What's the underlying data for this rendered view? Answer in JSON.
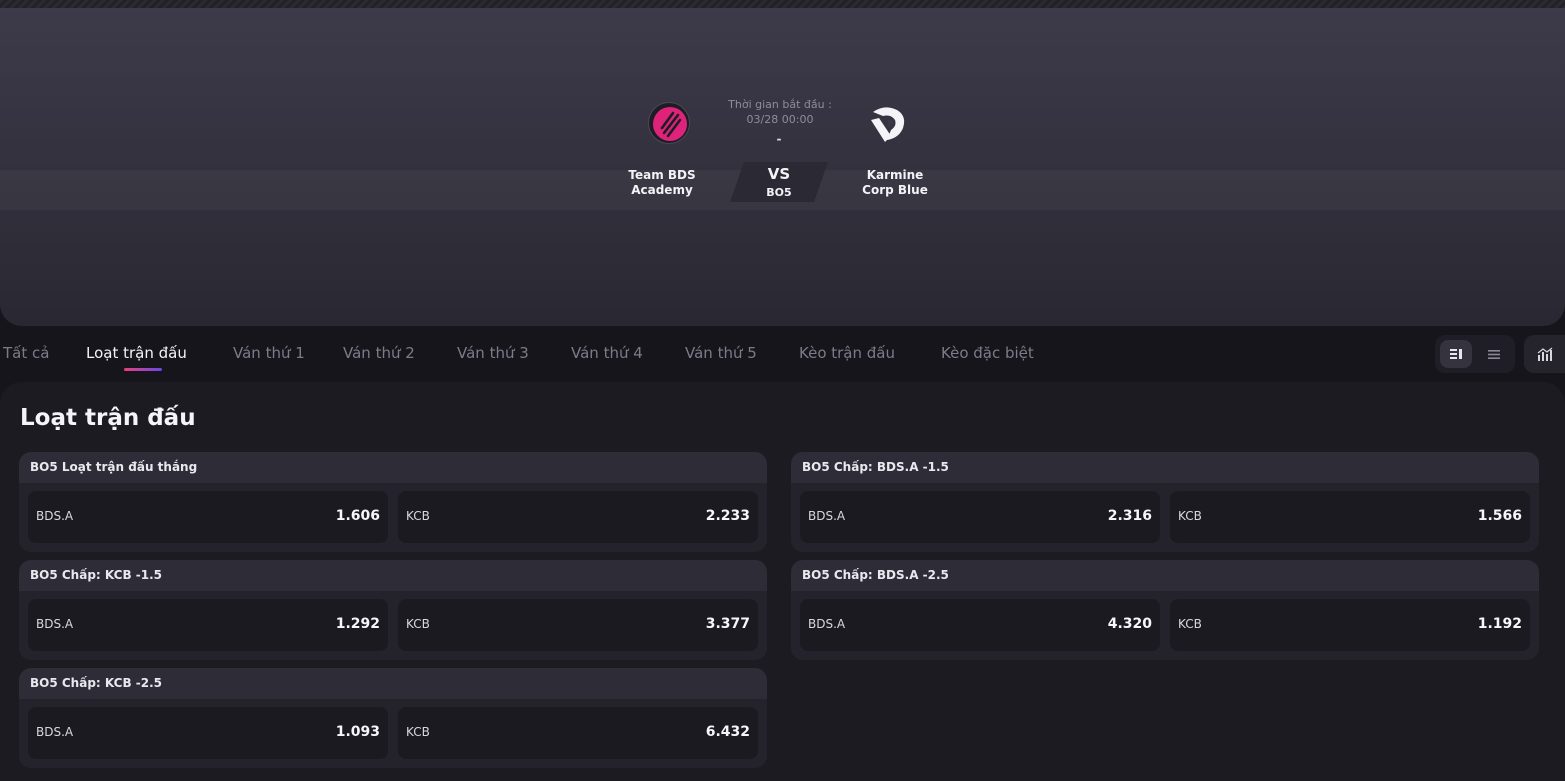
{
  "match": {
    "team_a": {
      "name": "Team BDS Academy",
      "line1": "Team BDS",
      "line2": "Academy",
      "logo": "bds-academy-logo"
    },
    "team_b": {
      "name": "Karmine Corp Blue",
      "line1": "Karmine",
      "line2": "Corp Blue",
      "logo": "karmine-corp-logo"
    },
    "start_label": "Thời gian bắt đầu :",
    "start_time": "03/28 00:00",
    "score": "-",
    "vs": "VS",
    "format": "BO5"
  },
  "tabs": [
    {
      "label": "Tất cả",
      "active": false
    },
    {
      "label": "Loạt trận đấu",
      "active": true
    },
    {
      "label": "Ván thứ 1",
      "active": false
    },
    {
      "label": "Ván thứ 2",
      "active": false
    },
    {
      "label": "Ván thứ 3",
      "active": false
    },
    {
      "label": "Ván thứ 4",
      "active": false
    },
    {
      "label": "Ván thứ 5",
      "active": false
    },
    {
      "label": "Kèo trận đấu",
      "active": false
    },
    {
      "label": "Kèo đặc biệt",
      "active": false
    }
  ],
  "view_buttons": {
    "compact": "layout-columns-icon",
    "list": "list-icon",
    "stats": "stats-chart-icon"
  },
  "section_title": "Loạt trận đấu",
  "markets": [
    {
      "title": "BO5 Loạt trận đấu thắng",
      "options": [
        {
          "name": "BDS.A",
          "odd": "1.606"
        },
        {
          "name": "KCB",
          "odd": "2.233"
        }
      ]
    },
    {
      "title": "BO5 Chấp: BDS.A -1.5",
      "options": [
        {
          "name": "BDS.A",
          "odd": "2.316"
        },
        {
          "name": "KCB",
          "odd": "1.566"
        }
      ]
    },
    {
      "title": "BO5 Chấp: KCB -1.5",
      "options": [
        {
          "name": "BDS.A",
          "odd": "1.292"
        },
        {
          "name": "KCB",
          "odd": "3.377"
        }
      ]
    },
    {
      "title": "BO5 Chấp: BDS.A -2.5",
      "options": [
        {
          "name": "BDS.A",
          "odd": "4.320"
        },
        {
          "name": "KCB",
          "odd": "1.192"
        }
      ]
    },
    {
      "title": "BO5 Chấp: KCB -2.5",
      "options": [
        {
          "name": "BDS.A",
          "odd": "1.093"
        },
        {
          "name": "KCB",
          "odd": "6.432"
        }
      ]
    }
  ],
  "colors": {
    "accent_start": "#e8407a",
    "accent_end": "#6a48e8",
    "background": "#16151c"
  }
}
